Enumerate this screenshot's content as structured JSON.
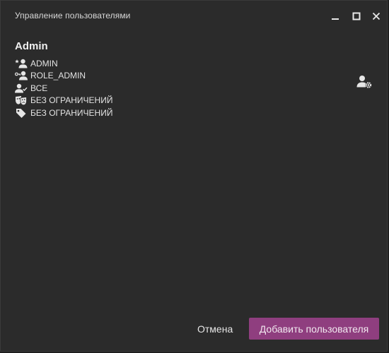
{
  "window": {
    "title": "Управление пользователями"
  },
  "user": {
    "name": "Admin",
    "rows": [
      {
        "icon": "person-star-icon",
        "text": "ADMIN"
      },
      {
        "icon": "person-key-icon",
        "text": "ROLE_ADMIN"
      },
      {
        "icon": "person-check-icon",
        "text": "ВСЕ"
      },
      {
        "icon": "masks-icon",
        "text": "БЕЗ ОГРАНИЧЕНИЙ"
      },
      {
        "icon": "tag-icon",
        "text": "БЕЗ ОГРАНИЧЕНИЙ"
      }
    ]
  },
  "actions": {
    "user_settings_icon": "user-settings-icon"
  },
  "footer": {
    "cancel_label": "Отмена",
    "add_label": "Добавить пользователя"
  },
  "colors": {
    "background": "#2b2b2b",
    "accent": "#8f3e7f",
    "text": "#e6e6e6"
  }
}
